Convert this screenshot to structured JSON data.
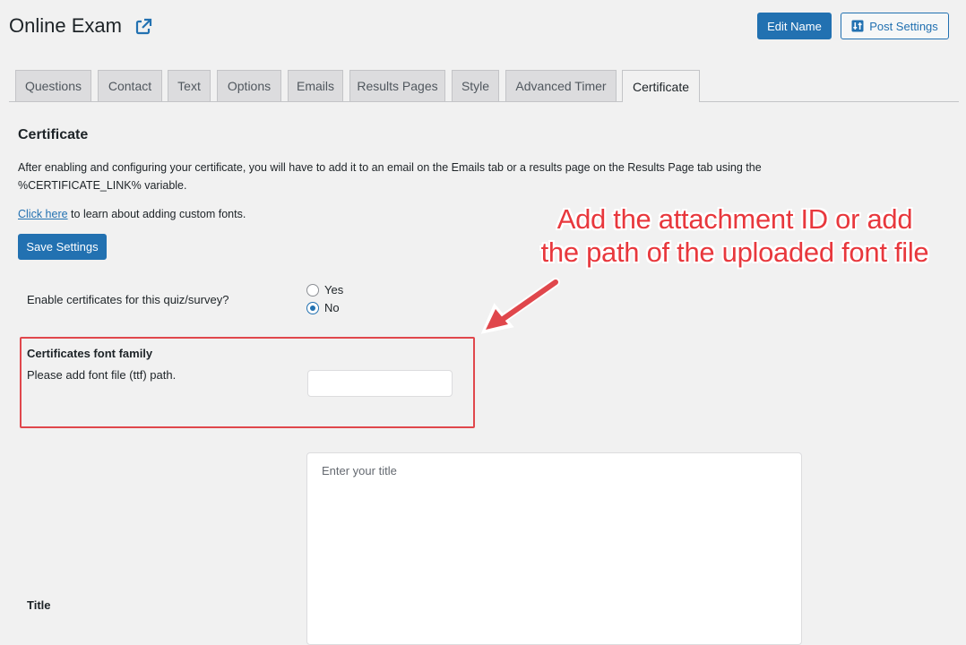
{
  "header": {
    "title": "Online Exam",
    "edit_name_label": "Edit Name",
    "post_settings_label": "Post Settings",
    "external_link_icon": "external-link-icon",
    "settings_icon": "sliders-icon"
  },
  "tabs": [
    {
      "label": "Questions",
      "active": false
    },
    {
      "label": "Contact",
      "active": false
    },
    {
      "label": "Text",
      "active": false
    },
    {
      "label": "Options",
      "active": false
    },
    {
      "label": "Emails",
      "active": false
    },
    {
      "label": "Results Pages",
      "active": false
    },
    {
      "label": "Style",
      "active": false
    },
    {
      "label": "Advanced Timer",
      "active": false
    },
    {
      "label": "Certificate",
      "active": true
    }
  ],
  "section": {
    "heading": "Certificate",
    "description": "After enabling and configuring your certificate, you will have to add it to an email on the Emails tab or a results page on the Results Page tab using the %CERTIFICATE_LINK% variable.",
    "help_link_text": "Click here",
    "help_rest_text": " to learn about adding custom fonts.",
    "save_label": "Save Settings"
  },
  "form": {
    "enable_label": "Enable certificates for this quiz/survey?",
    "enable_options": [
      {
        "label": "Yes",
        "checked": false
      },
      {
        "label": "No",
        "checked": true
      }
    ],
    "font_family_label": "Certificates font family",
    "font_family_hint": "Please add font file (ttf) path.",
    "font_family_value": "",
    "title_label": "Title",
    "title_placeholder": "Enter your title"
  },
  "annotation": {
    "line1": "Add the attachment ID or add",
    "line2": "the path of the uploaded font file",
    "color": "#e8383d"
  },
  "colors": {
    "primary": "#2271b1",
    "background": "#f1f1f1",
    "highlight": "#e0474c"
  }
}
